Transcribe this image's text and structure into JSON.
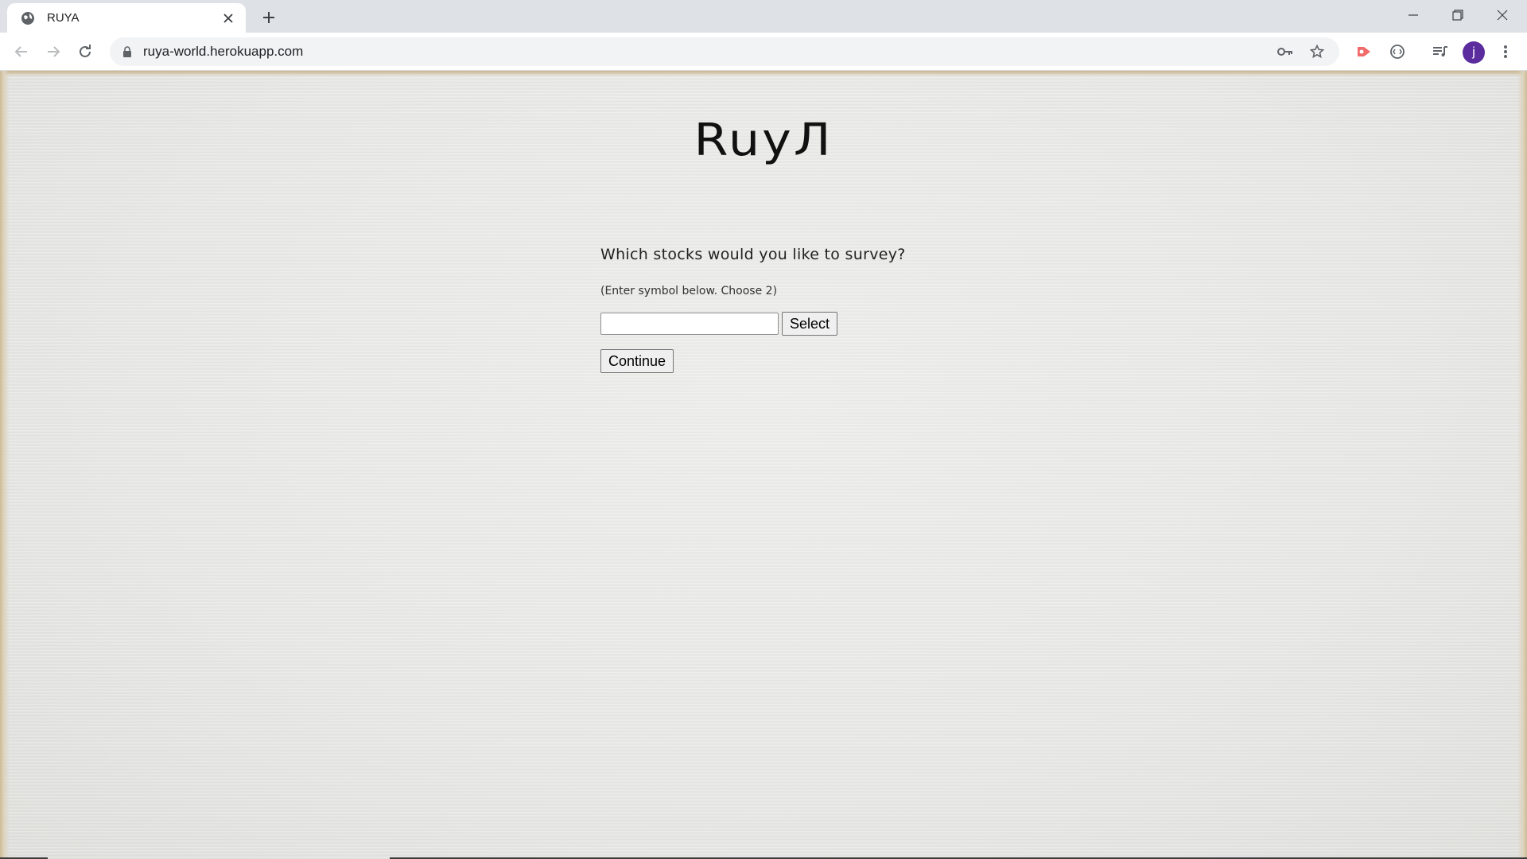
{
  "browser": {
    "tab": {
      "title": "RUYA",
      "favicon": "globe-icon"
    },
    "address": {
      "url": "ruya-world.herokuapp.com"
    },
    "profile": {
      "initial": "j",
      "color": "#5b2c9e"
    }
  },
  "page": {
    "logo": "RuyЛ",
    "question": "Which stocks would you like to survey?",
    "hint": "(Enter symbol below. Choose 2)",
    "symbol_input": {
      "value": "",
      "placeholder": ""
    },
    "select_label": "Select",
    "continue_label": "Continue"
  }
}
